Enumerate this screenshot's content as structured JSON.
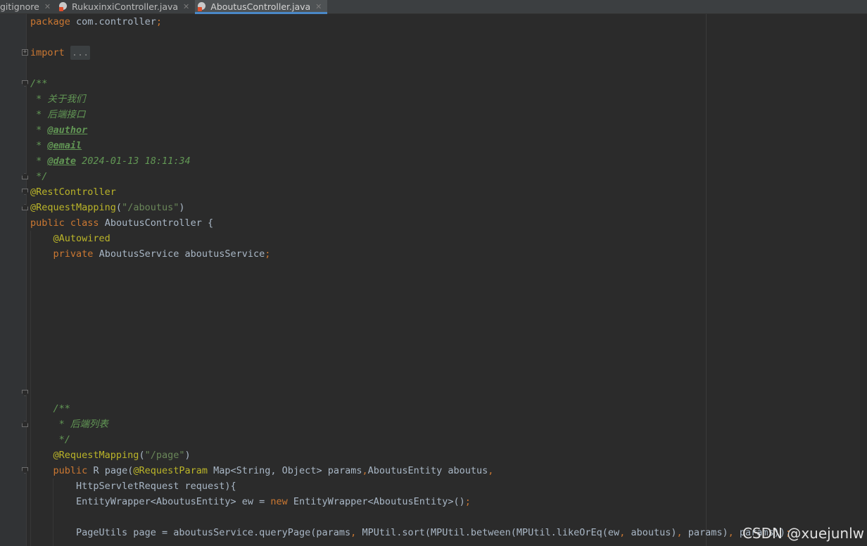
{
  "tabs": [
    {
      "label": ".gitignore",
      "close": "✕",
      "active": false
    },
    {
      "label": "RukuxinxiController.java",
      "close": "✕",
      "active": false
    },
    {
      "label": "AboutusController.java",
      "close": "✕",
      "active": true
    }
  ],
  "code": {
    "package_kw": "package",
    "package_name": "com.controller",
    "semicolon": ";",
    "import_kw": "import",
    "import_folded": "...",
    "doc_open": "/**",
    "doc_line1": " * 关于我们",
    "doc_line2": " * 后端接口",
    "doc_star": " * ",
    "tag_author": "@author",
    "tag_email": "@email",
    "tag_date": "@date",
    "date_value": " 2024-01-13 18:11:34",
    "doc_close": " */",
    "rest_controller": "@RestController",
    "request_mapping": "@RequestMapping",
    "mapping_path": "\"/aboutus\"",
    "public_kw": "public",
    "class_kw": "class",
    "class_name": "AboutusController {",
    "autowired": "@Autowired",
    "private_kw": "private",
    "field_decl": "AboutusService aboutusService",
    "doc2_open": "/**",
    "doc2_line": " * 后端列表",
    "doc2_close": " */",
    "page_path": "\"/page\"",
    "method_sig_1": "R page(",
    "request_param": "@RequestParam",
    "method_sig_2": " Map<String, Object> params",
    "comma": ",",
    "method_sig_3": "AboutusEntity aboutus",
    "method_sig_4": "HttpServletRequest request){",
    "ew_decl": "EntityWrapper<AboutusEntity> ew = ",
    "new_kw": "new",
    "ew_ctor": " EntityWrapper<AboutusEntity>()",
    "page_line_a": "PageUtils page = aboutusService.queryPage(params",
    "page_line_b": " MPUtil.sort(MPUtil.between(MPUtil.likeOrEq(ew",
    "page_line_c": " aboutus)",
    "page_line_d": " params)",
    "page_line_e": " params))"
  },
  "watermark": "CSDN @xuejunlw"
}
